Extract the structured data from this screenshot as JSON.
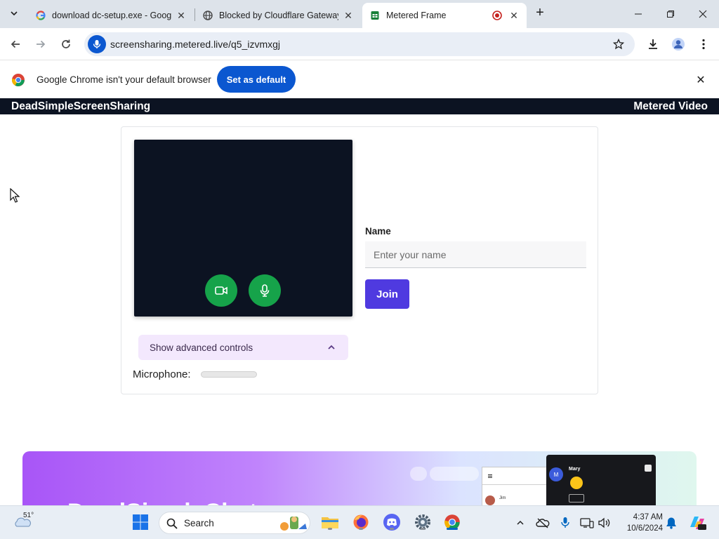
{
  "browser": {
    "tabs": [
      {
        "title": "download dc-setup.exe - Goog",
        "icon": "google-g-icon",
        "active": false
      },
      {
        "title": "Blocked by Cloudflare Gateway",
        "icon": "globe-icon",
        "active": false
      },
      {
        "title": "Metered Frame",
        "icon": "sheets-icon",
        "active": true,
        "recording": true
      }
    ],
    "url": "screensharing.metered.live/q5_izvmxgj",
    "infobar": {
      "message": "Google Chrome isn't your default browser",
      "button": "Set as default"
    }
  },
  "site": {
    "brand_left": "DeadSimpleScreenSharing",
    "brand_right": "Metered Video"
  },
  "join_form": {
    "name_label": "Name",
    "name_placeholder": "Enter your name",
    "name_value": "",
    "join_button": "Join",
    "advanced_controls": "Show advanced controls",
    "microphone_label": "Microphone:",
    "microphone_level": 0
  },
  "promo": {
    "title": "DeadSimpleChat",
    "chat_user": "Mary",
    "chat_avatar_letter": "M",
    "list_user": "Jim"
  },
  "taskbar": {
    "temperature": "51°",
    "search_label": "Search",
    "time": "4:37 AM",
    "date": "10/6/2024"
  },
  "colors": {
    "accent_blue": "#0b57d0",
    "join_purple": "#4f3ae0",
    "control_green": "#16a34a",
    "site_header": "#0c1322"
  }
}
